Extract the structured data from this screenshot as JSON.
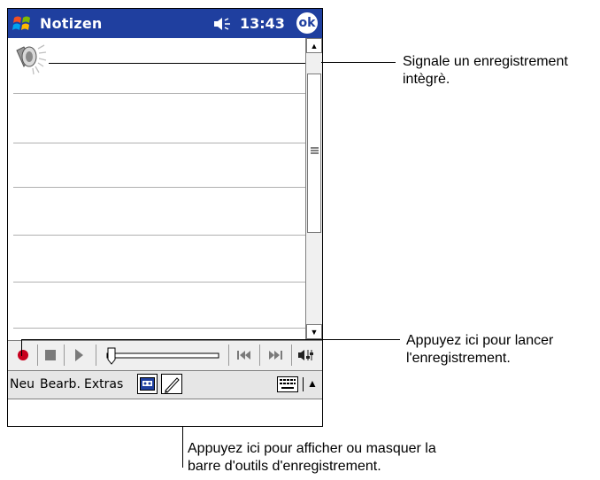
{
  "app": {
    "title": "Notizen",
    "clock": "13:43",
    "ok_label": "ok",
    "icons": {
      "start": "windows-flag-icon",
      "speaker_status": "speaker-icon",
      "recording": "speaker-recording-icon"
    }
  },
  "menubar": {
    "items": [
      "Neu",
      "Bearb.",
      "Extras"
    ]
  },
  "callouts": {
    "embedded_recording": [
      "Signale un enregistrement",
      "intègrè."
    ],
    "start_recording": [
      "Appuyez ici pour lancer",
      "l'enregistrement."
    ],
    "toggle_toolbar": [
      "Appuyez ici pour afficher ou masquer la",
      "barre d'outils d'enregistrement."
    ]
  },
  "colors": {
    "titlebar": "#1f3f9f",
    "record": "#c8001e"
  }
}
